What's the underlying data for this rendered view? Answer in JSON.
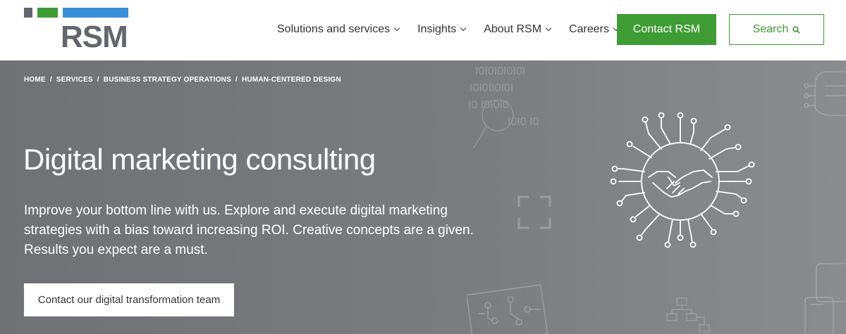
{
  "brand": {
    "name": "RSM",
    "colors": {
      "gray": "#63666a",
      "green": "#3f9c35",
      "blue": "#3b8fd9"
    }
  },
  "nav": {
    "items": [
      {
        "label": "Solutions and services"
      },
      {
        "label": "Insights"
      },
      {
        "label": "About RSM"
      },
      {
        "label": "Careers"
      }
    ],
    "contact_label": "Contact RSM",
    "search_label": "Search"
  },
  "breadcrumb": {
    "items": [
      "HOME",
      "/",
      "SERVICES",
      "/",
      "BUSINESS STRATEGY OPERATIONS",
      "/",
      "HUMAN-CENTERED DESIGN"
    ]
  },
  "hero": {
    "title": "Digital marketing consulting",
    "description_lines": [
      "Improve your bottom line with us. Explore and execute digital marketing",
      "strategies with a bias toward increasing ROI. Creative concepts are a given.",
      "Results you expect are a must."
    ],
    "cta_label": "Contact our digital transformation team",
    "binary_rows": [
      "I0I0I0I0I0I",
      "I0I0II0I0I",
      "I0 I0I0I0",
      "I0I0 I0"
    ]
  }
}
